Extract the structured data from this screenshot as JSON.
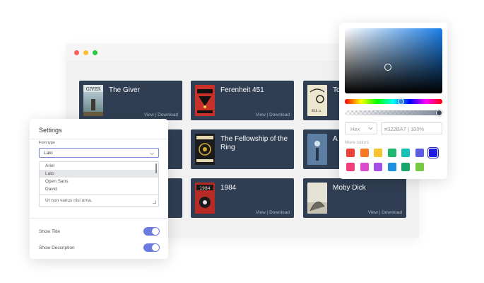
{
  "books": [
    {
      "title": "The Giver",
      "links": "View | Download"
    },
    {
      "title": "Ferenheit 451",
      "links": "View | Download"
    },
    {
      "title": "To",
      "links": ""
    },
    {
      "title": "",
      "links": ""
    },
    {
      "title": "The Fellowship of the Ring",
      "links": ""
    },
    {
      "title": "A",
      "links": ""
    },
    {
      "title": "",
      "links": ""
    },
    {
      "title": "1984",
      "links": "View | Download"
    },
    {
      "title": "Moby Dick",
      "links": "View | Download"
    }
  ],
  "settings": {
    "title": "Settings",
    "font_label": "Font type",
    "font_value": "Lato",
    "font_options": [
      "Ariel",
      "Lato",
      "Open Sans",
      "David"
    ],
    "textarea_value": "Ut non varius nisi urna.",
    "toggles": [
      {
        "label": "Show Title",
        "on": true
      },
      {
        "label": "Show Description",
        "on": true
      }
    ]
  },
  "picker": {
    "format": "Hex",
    "value": "#322BA7 | 100%",
    "more_colors_label": "More colors",
    "swatches": [
      "#e8423a",
      "#f47b26",
      "#f5c32d",
      "#20b66f",
      "#17c1b4",
      "#5d5be0",
      "#1e1ae8",
      "#ef3e7a",
      "#d94ccf",
      "#a64ee8",
      "#1f8fe0",
      "#17a56b",
      "#7ac943"
    ],
    "hue_fraction": 0.58,
    "alpha_fraction": 1.0
  },
  "colors": {
    "card_bg": "#2f3e52",
    "accent": "#6b7cde"
  }
}
